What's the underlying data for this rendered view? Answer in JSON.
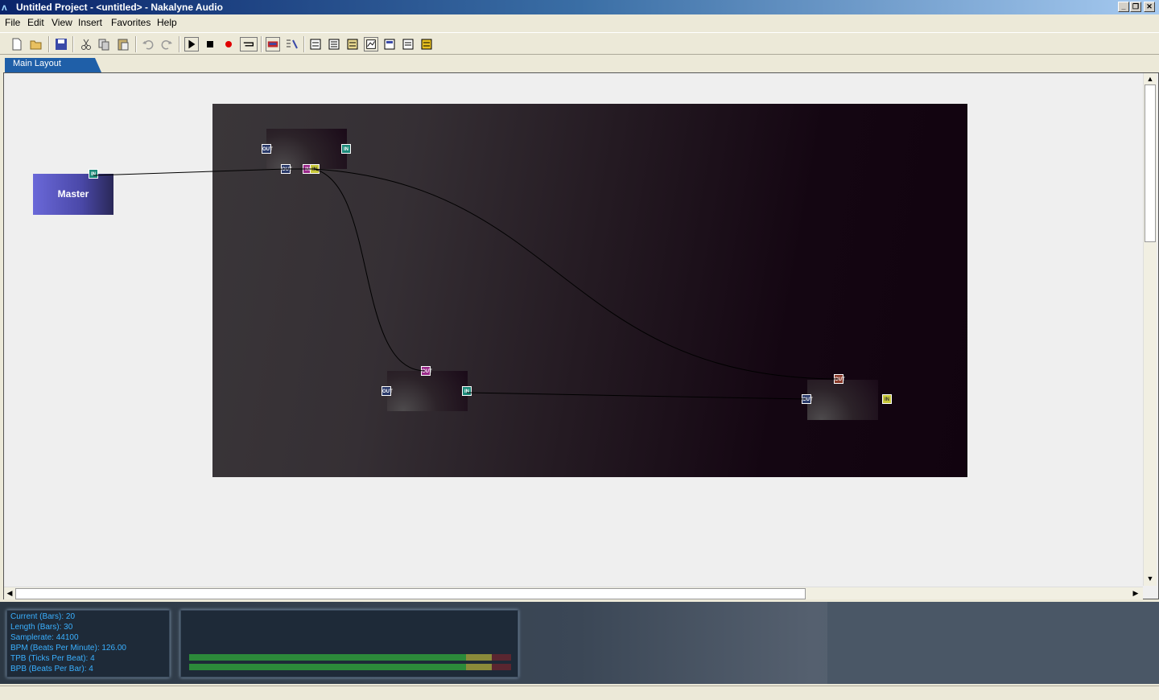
{
  "window": {
    "title": "Untitled Project - <untitled> - Nakalyne Audio",
    "minimize": "_",
    "restore": "❐",
    "close": "✕"
  },
  "menu": [
    "File",
    "Edit",
    "View",
    "Insert",
    "Favorites",
    "Help"
  ],
  "toolbar": {
    "icons": [
      "new-icon",
      "open-icon",
      "save-icon",
      "cut-icon",
      "copy-icon",
      "paste-icon",
      "undo-icon",
      "redo-icon",
      "play-icon",
      "stop-icon",
      "record-icon",
      "loop-icon",
      "mixer-icon",
      "tools-icon",
      "view1-icon",
      "view2-icon",
      "view3-icon",
      "view4-icon",
      "view5-icon",
      "view6-icon",
      "view7-icon"
    ]
  },
  "tabs": [
    "Main Layout"
  ],
  "layout": {
    "master_label": "Master",
    "port_labels": {
      "out": "OUT",
      "in": "IN"
    }
  },
  "info": {
    "current": "Current (Bars): 20",
    "length": "Length (Bars): 30",
    "samplerate": "Samplerate: 44100",
    "bpm": "BPM (Beats Per Minute): 126.00",
    "tpb": "TPB (Ticks Per Beat): 4",
    "bpb": "BPB (Beats Per Bar): 4"
  },
  "meters": [
    {
      "green": 0.86,
      "yellow": 0.94
    },
    {
      "green": 0.86,
      "yellow": 0.94
    }
  ],
  "colors": {
    "tab_active": "#1f5fa8",
    "info_text": "#3ab0ff",
    "master_node": "#5a58c8"
  }
}
